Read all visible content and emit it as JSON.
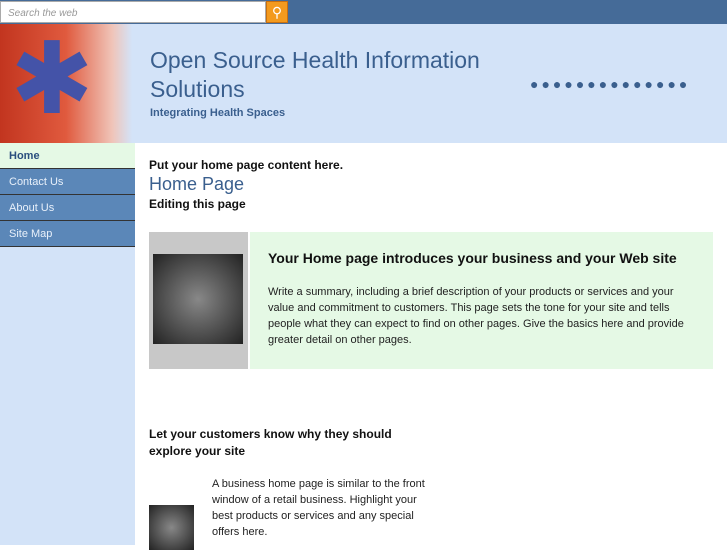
{
  "search": {
    "placeholder": "Search the web",
    "icon": "search-icon"
  },
  "header": {
    "title": "Open Source Health Information Solutions",
    "tagline": "Integrating Health Spaces",
    "dots": "●●●●●●●●●●●●●●"
  },
  "nav": [
    {
      "label": "Home"
    },
    {
      "label": "Contact Us"
    },
    {
      "label": "About Us"
    },
    {
      "label": "Site Map"
    }
  ],
  "main": {
    "intro": "Put your home page content here.",
    "page_title": "Home Page",
    "editing": "Editing this page",
    "feature_title": "Your Home page introduces your business and your Web site",
    "feature_text": "Write a summary, including a brief description of your products or services and your value and commitment to customers. This page sets the tone for your site and tells people what they can expect to find on other pages. Give the basics here and provide greater detail on other pages.",
    "section2_title": "Let your customers know why they should explore your site",
    "section2_text": "A business home page is similar to the front window of a retail business. Highlight your best products or services and any special offers here."
  }
}
